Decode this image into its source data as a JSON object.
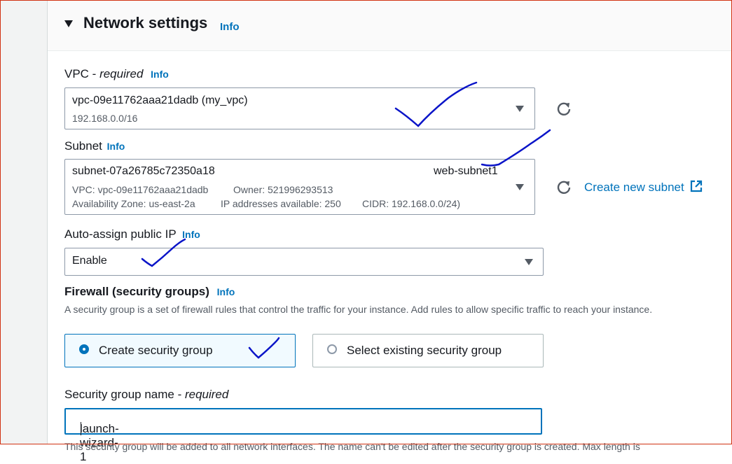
{
  "section": {
    "title": "Network settings",
    "info": "Info"
  },
  "vpc": {
    "label": "VPC - ",
    "required": "required",
    "info": "Info",
    "value": "vpc-09e11762aaa21dadb (my_vpc)",
    "cidr": "192.168.0.0/16"
  },
  "subnet": {
    "label": "Subnet",
    "info": "Info",
    "id": "subnet-07a26785c72350a18",
    "name": "web-subnet1",
    "vpc": "VPC: vpc-09e11762aaa21dadb",
    "owner": "Owner: 521996293513",
    "az": "Availability Zone: us-east-2a",
    "ips": "IP addresses available: 250",
    "cidr": "CIDR: 192.168.0.0/24)",
    "create_link": "Create new subnet"
  },
  "auto_ip": {
    "label": "Auto-assign public IP",
    "info": "Info",
    "value": "Enable"
  },
  "firewall": {
    "label": "Firewall (security groups)",
    "info": "Info",
    "description": "A security group is a set of firewall rules that control the traffic for your instance. Add rules to allow specific traffic to reach your instance.",
    "option_create": "Create security group",
    "option_existing": "Select existing security group",
    "selected": "create"
  },
  "sg_name": {
    "label": "Security group name - ",
    "required": "required",
    "value": "launch-wizard-1"
  },
  "footer_text": "This security group will be added to all network interfaces. The name can't be edited after the security group is created. Max length is",
  "colors": {
    "link": "#0073bb",
    "annotation": "#0a14c8",
    "frame": "#d13212"
  },
  "icons": [
    "caret-down-icon",
    "refresh-icon",
    "external-link-icon",
    "dropdown-arrow-icon",
    "radio-icon"
  ]
}
